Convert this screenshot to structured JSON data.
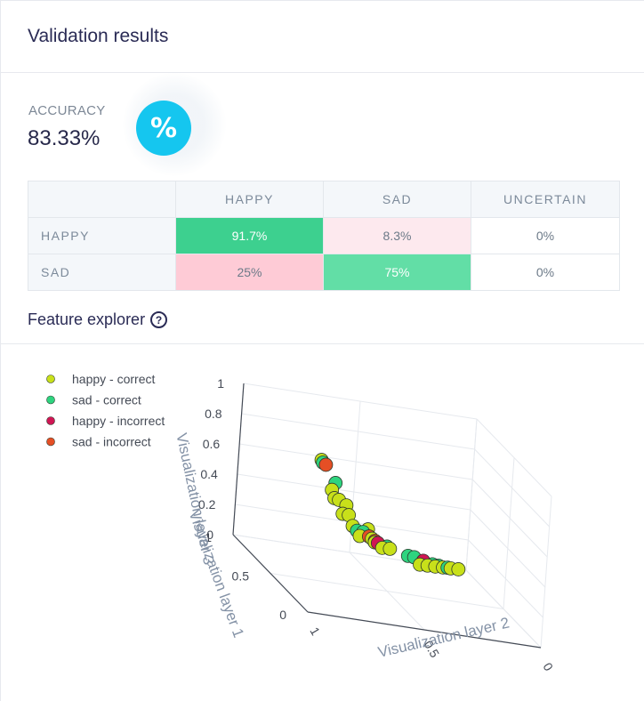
{
  "header": {
    "title": "Validation results"
  },
  "accuracy": {
    "label": "ACCURACY",
    "value": "83.33%",
    "icon": "percent-icon",
    "icon_symbol": "%"
  },
  "confusion_matrix": {
    "columns": [
      "HAPPY",
      "SAD",
      "UNCERTAIN"
    ],
    "rows": [
      {
        "label": "HAPPY",
        "cells": [
          "91.7%",
          "8.3%",
          "0%"
        ]
      },
      {
        "label": "SAD",
        "cells": [
          "25%",
          "75%",
          "0%"
        ]
      }
    ]
  },
  "feature_explorer": {
    "title": "Feature explorer",
    "help_icon": "question-circle-icon",
    "help_symbol": "?"
  },
  "chart_data": {
    "type": "scatter",
    "is_3d": true,
    "legend_position": "top-left",
    "series": [
      {
        "name": "happy - correct",
        "color": "#c8e01a",
        "points": [
          [
            0.02,
            0.98,
            1.0
          ],
          [
            0.1,
            0.9,
            0.78
          ],
          [
            0.12,
            0.88,
            0.72
          ],
          [
            0.15,
            0.85,
            0.7
          ],
          [
            0.18,
            0.82,
            0.6
          ],
          [
            0.2,
            0.8,
            0.65
          ],
          [
            0.22,
            0.78,
            0.58
          ],
          [
            0.25,
            0.75,
            0.5
          ],
          [
            0.3,
            0.7,
            0.42
          ],
          [
            0.35,
            0.65,
            0.45
          ],
          [
            0.38,
            0.62,
            0.38
          ],
          [
            0.4,
            0.6,
            0.35
          ],
          [
            0.45,
            0.55,
            0.3
          ],
          [
            0.5,
            0.5,
            0.28
          ],
          [
            0.7,
            0.3,
            0.12
          ],
          [
            0.75,
            0.25,
            0.1
          ],
          [
            0.8,
            0.2,
            0.08
          ],
          [
            0.85,
            0.15,
            0.06
          ],
          [
            0.9,
            0.1,
            0.04
          ],
          [
            0.95,
            0.05,
            0.02
          ]
        ]
      },
      {
        "name": "sad - correct",
        "color": "#2ed47f",
        "points": [
          [
            0.03,
            0.97,
            0.98
          ],
          [
            0.12,
            0.88,
            0.82
          ],
          [
            0.28,
            0.72,
            0.46
          ],
          [
            0.32,
            0.68,
            0.44
          ],
          [
            0.48,
            0.52,
            0.3
          ],
          [
            0.62,
            0.38,
            0.2
          ],
          [
            0.66,
            0.34,
            0.18
          ],
          [
            0.78,
            0.22,
            0.1
          ],
          [
            0.82,
            0.18,
            0.08
          ],
          [
            0.88,
            0.12,
            0.05
          ]
        ]
      },
      {
        "name": "happy - incorrect",
        "color": "#d01654",
        "points": [
          [
            0.42,
            0.58,
            0.34
          ],
          [
            0.72,
            0.28,
            0.14
          ]
        ]
      },
      {
        "name": "sad - incorrect",
        "color": "#e54f25",
        "points": [
          [
            0.05,
            0.95,
            0.96
          ],
          [
            0.36,
            0.64,
            0.4
          ],
          [
            0.4,
            0.6,
            0.36
          ]
        ]
      }
    ],
    "axes": {
      "x": {
        "label": "Visualization layer 1",
        "ticks": [
          "0",
          "0.5",
          "1"
        ],
        "range": [
          0,
          1
        ]
      },
      "y": {
        "label": "Visualization layer 2",
        "ticks": [
          "0",
          "0.5",
          "1"
        ],
        "range": [
          0,
          1
        ]
      },
      "z": {
        "label": "Visualization layer 3",
        "ticks": [
          "0",
          "0.2",
          "0.4",
          "0.6",
          "0.8",
          "1"
        ],
        "range": [
          0,
          1
        ]
      }
    },
    "grid": true
  }
}
